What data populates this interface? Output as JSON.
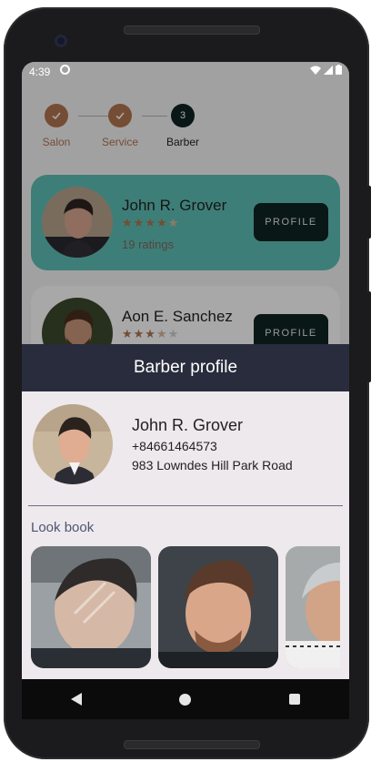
{
  "status": {
    "time": "4:39"
  },
  "stepper": {
    "steps": [
      {
        "label": "Salon",
        "icon": "check-icon",
        "state": "done"
      },
      {
        "label": "Service",
        "icon": "check-icon",
        "state": "done"
      },
      {
        "label": "Barber",
        "number": "3",
        "state": "active"
      }
    ]
  },
  "barbers": [
    {
      "name": "John R. Grover",
      "rating": 4.5,
      "ratings_label": "19 ratings",
      "button": "PROFILE",
      "selected": true
    },
    {
      "name": "Aon E. Sanchez",
      "rating": 3.5,
      "button": "PROFILE",
      "selected": false
    }
  ],
  "sheet": {
    "title": "Barber profile",
    "name": "John R. Grover",
    "phone": "+84661464573",
    "address": "983 Lowndes Hill Park Road",
    "lookbook_title": "Look book"
  },
  "colors": {
    "accent_brown": "#b07650",
    "selected_card": "#5fc0b6",
    "header": "#282c3c",
    "star": "#b07650"
  }
}
